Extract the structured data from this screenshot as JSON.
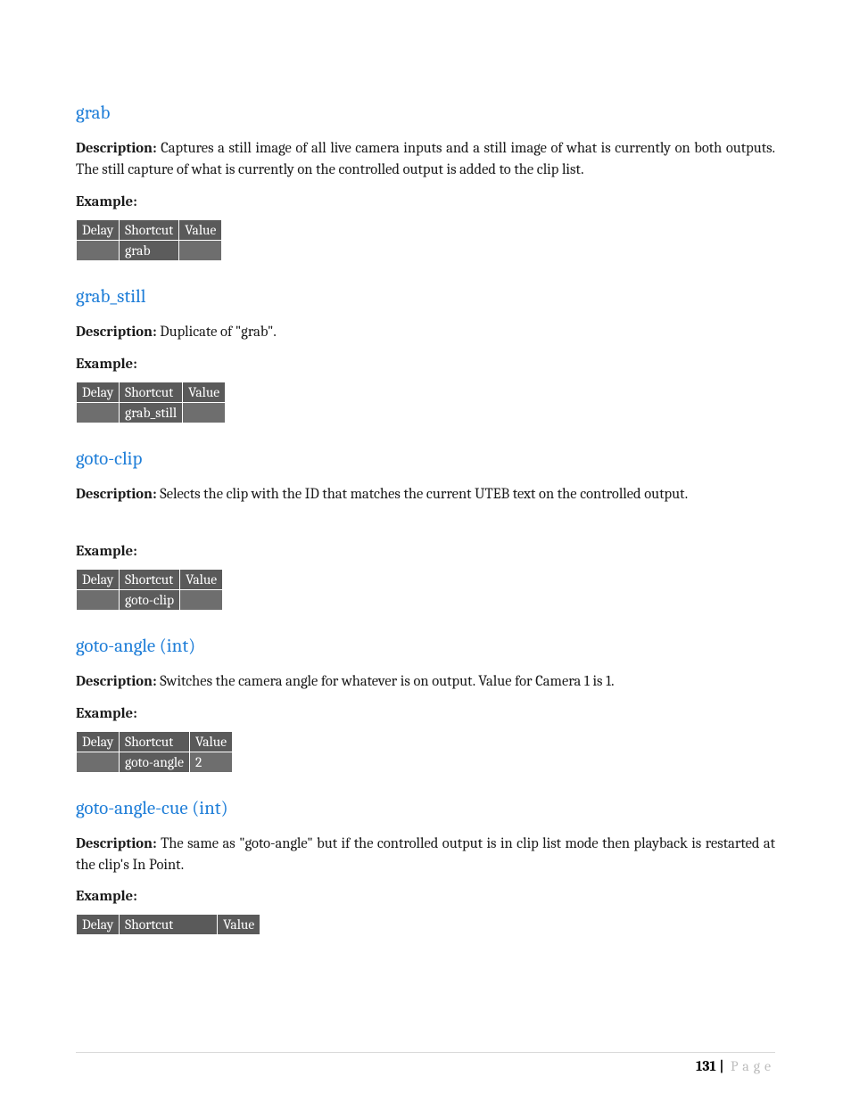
{
  "labels": {
    "description": "Description:",
    "example": "Example:"
  },
  "table_headers": {
    "delay": "Delay",
    "shortcut": "Shortcut",
    "value": "Value"
  },
  "sections": [
    {
      "heading": "grab",
      "description": "Captures a still image of all live camera inputs and a still image of what is currently on both outputs.  The still capture of what is currently on the controlled output is added to the clip list.",
      "justify": true,
      "row": {
        "delay": "",
        "shortcut": "grab",
        "value": ""
      }
    },
    {
      "heading": "grab_still",
      "description": "Duplicate of \"grab\".",
      "justify": false,
      "row": {
        "delay": "",
        "shortcut": "grab_still",
        "value": ""
      }
    },
    {
      "heading": "goto-clip",
      "description": "Selects the clip with the ID that matches the current UTEB text on the controlled output.",
      "justify": false,
      "extra_gap": true,
      "row": {
        "delay": "",
        "shortcut": "goto-clip",
        "value": ""
      }
    },
    {
      "heading": "goto-angle (int)",
      "description": "Switches the camera angle for whatever is on output.  Value for Camera 1 is 1.",
      "justify": false,
      "row": {
        "delay": "",
        "shortcut": "goto-angle",
        "value": "2"
      }
    },
    {
      "heading": "goto-angle-cue (int)",
      "description": "The same as \"goto-angle\" but if the controlled output is in clip list mode then playback is restarted at the clip's In Point.",
      "justify": true,
      "header_only": true,
      "row": {
        "delay": "",
        "shortcut": "",
        "value": ""
      }
    }
  ],
  "footer": {
    "page_number": "131",
    "page_word": "Page"
  }
}
